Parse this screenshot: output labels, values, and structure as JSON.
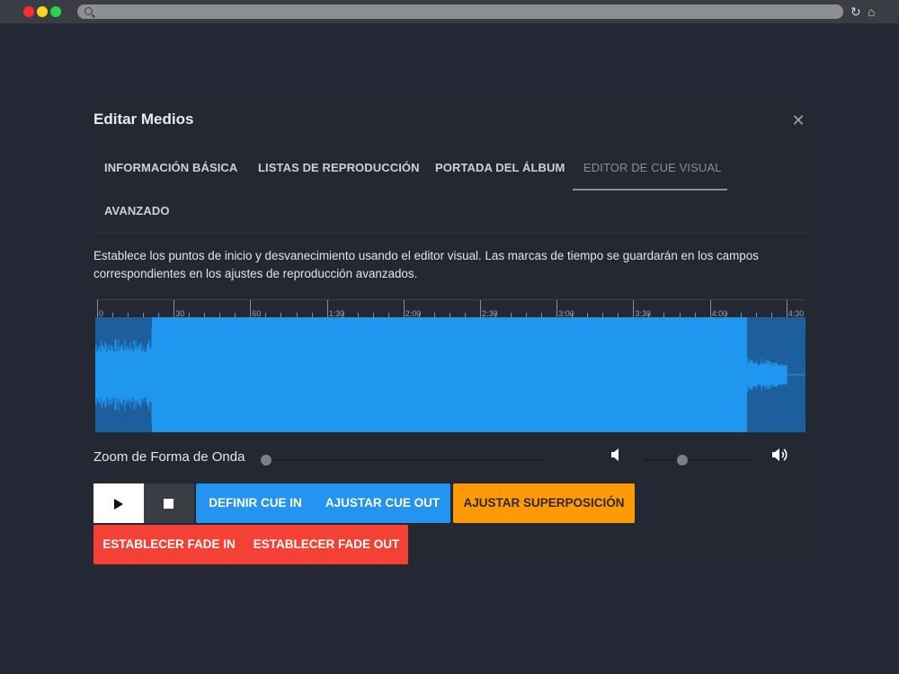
{
  "browser": {
    "reload_icon": "reload-icon",
    "home_icon": "home-icon"
  },
  "dialog": {
    "title": "Editar Medios",
    "close_icon": "close-icon",
    "tabs": [
      {
        "label": "Información Básica",
        "active": false
      },
      {
        "label": "Listas de Reproducción",
        "active": false
      },
      {
        "label": "Portada del Álbum",
        "active": false
      },
      {
        "label": "Editor de Cue Visual",
        "active": true
      },
      {
        "label": "Avanzado",
        "active": false
      }
    ],
    "description": "Establece los puntos de inicio y desvanecimiento usando el editor visual. Las marcas de tiempo se guardarán en los campos correspondientes en los ajustes de reproducción avanzados."
  },
  "timeline": {
    "labels": [
      "0",
      "30",
      "60",
      "1:30",
      "2:00",
      "2:30",
      "3:00",
      "3:30",
      "4:00",
      "4:30"
    ]
  },
  "controls": {
    "zoom_label": "Zoom de Forma de Onda",
    "zoom_level": 0.0,
    "volume_level": 0.35,
    "volume_low_icon": "volume-low-icon",
    "volume_high_icon": "volume-high-icon"
  },
  "buttons": {
    "play_icon": "play-icon",
    "stop_icon": "stop-icon",
    "set_cue_in": "Definir Cue In",
    "set_cue_out": "Ajustar Cue Out",
    "set_overlap": "Ajustar Superposición",
    "set_fade_in": "Establecer Fade In",
    "set_fade_out": "Establecer Fade Out"
  },
  "colors": {
    "waveform": "#2097ee",
    "waveform_bg": "#1d5f9c",
    "primary": "#2394ef",
    "warning": "#ff9a06",
    "danger": "#f44136"
  }
}
